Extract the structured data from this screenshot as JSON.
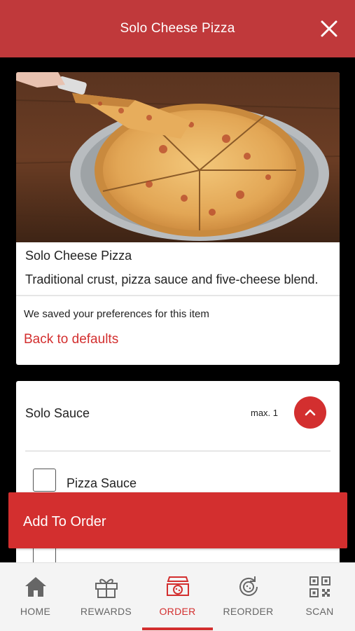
{
  "header": {
    "title": "Solo Cheese Pizza",
    "close_icon": "close-icon"
  },
  "item": {
    "image_icon": "pizza-photo",
    "name": "Solo Cheese Pizza",
    "description": "Traditional crust, pizza sauce and five-cheese blend.",
    "preferences_note": "We saved your preferences for this item",
    "back_to_defaults": "Back to defaults"
  },
  "sauce_section": {
    "title": "Solo Sauce",
    "max": "max. 1",
    "toggle_icon": "chevron-up-icon",
    "options": [
      {
        "label": "Pizza Sauce",
        "checked": false
      }
    ]
  },
  "add_to_order": {
    "label": "Add To Order"
  },
  "nav": {
    "items": [
      {
        "label": "HOME",
        "icon": "home-icon",
        "active": false
      },
      {
        "label": "REWARDS",
        "icon": "gift-icon",
        "active": false
      },
      {
        "label": "ORDER",
        "icon": "pizza-box-icon",
        "active": true
      },
      {
        "label": "REORDER",
        "icon": "reorder-icon",
        "active": false
      },
      {
        "label": "SCAN",
        "icon": "qr-code-icon",
        "active": false
      }
    ]
  },
  "colors": {
    "header": "#c0393b",
    "accent": "#d32f2f",
    "nav_inactive": "#666666"
  }
}
